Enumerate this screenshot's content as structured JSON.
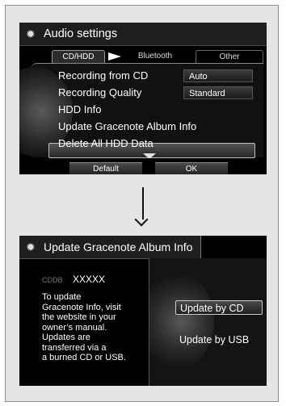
{
  "audio_settings": {
    "title": "Audio settings",
    "tabs": [
      {
        "label": "CD/HDD"
      },
      {
        "label": "Bluetooth"
      },
      {
        "label": "Other"
      }
    ],
    "menu": [
      {
        "label": "Recording from CD",
        "value": "Auto"
      },
      {
        "label": "Recording Quality",
        "value": "Standard"
      },
      {
        "label": "HDD Info"
      },
      {
        "label": "Update Gracenote Album Info",
        "selected": true
      },
      {
        "label": "Delete All HDD Data"
      }
    ],
    "softkeys": {
      "default_label": "Default",
      "ok_label": "OK"
    }
  },
  "update_screen": {
    "title": "Update Gracenote Album Info",
    "cddb_label": "CDDB",
    "cddb_value": "XXXXX",
    "description": "To update\nGracenote Info, visit\nthe website in your\nowner’s manual.\nUpdates are\ntransferred via a\na burned CD or USB.",
    "buttons": [
      {
        "label": "Update by CD",
        "selected": true
      },
      {
        "label": "Update by USB"
      }
    ]
  },
  "icons": {
    "settings": "gear-icon",
    "transition": "down-arrow-icon"
  },
  "colors": {
    "screen_bg": "#000000",
    "frame_bg": "#e5e5e5",
    "highlight_border": "#bbbbbb"
  }
}
